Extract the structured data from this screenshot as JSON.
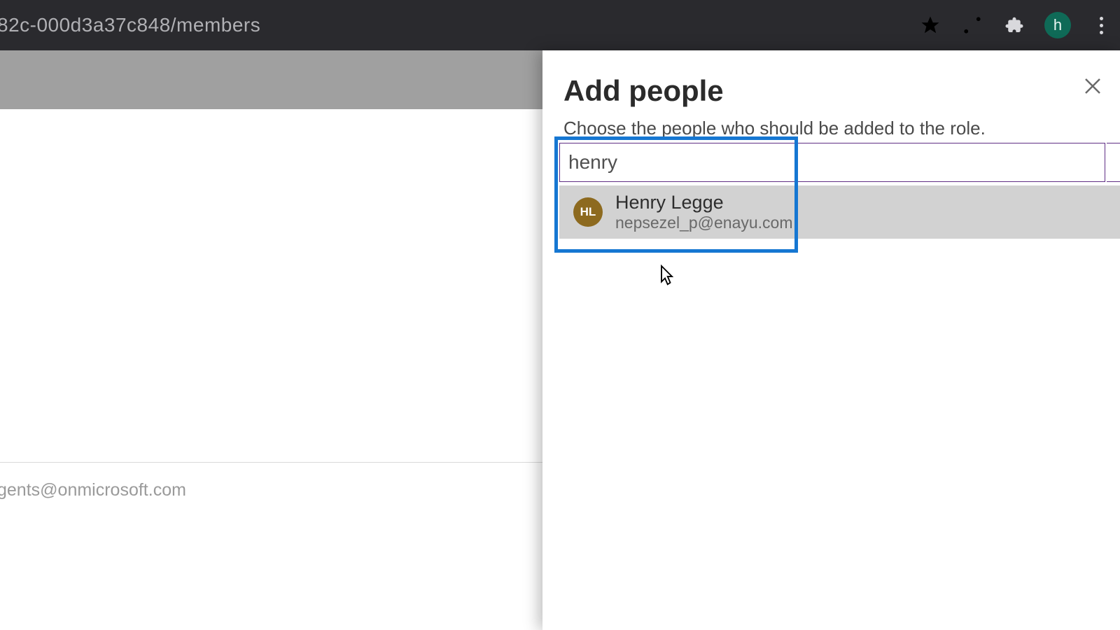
{
  "browser": {
    "url_fragment": "82c-000d3a37c848/members",
    "profile_letter": "h"
  },
  "background": {
    "partial_email": "gents@onmicrosoft.com"
  },
  "dialog": {
    "title": "Add people",
    "subtitle": "Choose the people who should be added to the role.",
    "search_value": "henry",
    "suggestion": {
      "initials": "HL",
      "name": "Henry Legge",
      "email": "nepsezel_p@enayu.com"
    }
  }
}
